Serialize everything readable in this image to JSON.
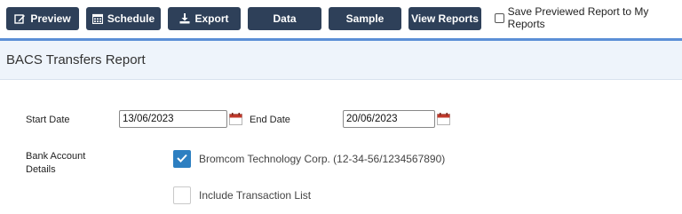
{
  "toolbar": {
    "preview": "Preview",
    "schedule": "Schedule",
    "export": "Export",
    "data": "Data",
    "sample": "Sample",
    "view_reports": "View Reports",
    "save_previewed": "Save Previewed Report to My Reports"
  },
  "panel": {
    "title": "BACS Transfers Report"
  },
  "form": {
    "start_date_label": "Start Date",
    "start_date_value": "13/06/2023",
    "end_date_label": "End Date",
    "end_date_value": "20/06/2023",
    "bank_label_line1": "Bank Account",
    "bank_label_line2": "Details",
    "bank_account_option": "Bromcom Technology Corp. (12-34-56/1234567890)",
    "include_transactions": "Include Transaction List"
  },
  "colors": {
    "toolbar_button": "#2e4059",
    "accent": "#5b8fd6",
    "header_bg": "#eef4fb",
    "checkbox_checked": "#2d7fc1",
    "calendar_icon": "#c0392b"
  },
  "state": {
    "save_previewed_checked": false,
    "bank_account_checked": true,
    "include_transactions_checked": false
  }
}
